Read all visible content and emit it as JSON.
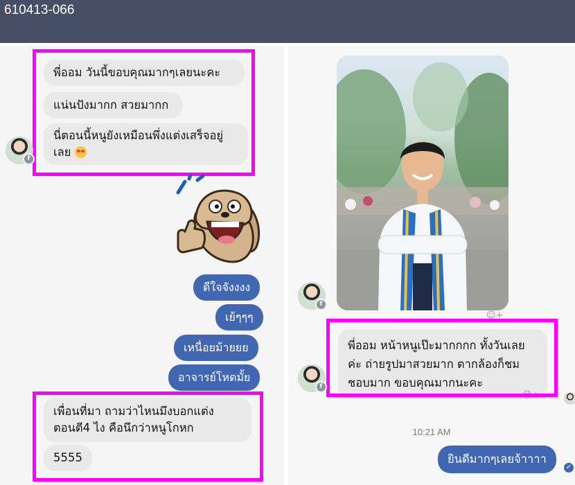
{
  "header": {
    "title": "610413-066"
  },
  "left": {
    "top_messages": [
      "พี่ออม วันนี้ขอบคุณมากๆเลยนะคะ",
      "แน่นปังมากก สวยมากก",
      "นี่ตอนนี้หนูยังเหมือนพึ่งแต่งเสร็จอยู่",
      "เลย"
    ],
    "sent_messages": [
      "ดีใจจังงงง",
      "เย้ๆๆๆ",
      "เหนื่อยม้ายยย",
      "อาจารย์โหดมั้ย"
    ],
    "bottom_messages": [
      "เพื่อนที่มา ถามว่าไหนมึงบอกแต่ง",
      "ตอนตี4 ไง คือนึกว่าหนูโกหก",
      "5555"
    ]
  },
  "right": {
    "message_lines": [
      "พี่ออม หน้าหนูเป๊ะมากกกก ทั้งวันเลย",
      "ค่ะ ถ่ายรูปมาสวยมาก ตากล้องก็ชม",
      "ชอบมาก ขอบคุณมากนะคะ"
    ],
    "timestamp": "10:21 AM",
    "sent_message": "ยินดีมากๆเลยจ้าาาา"
  },
  "icons": {
    "reaction": "add-reaction-icon",
    "facebook_badge": "facebook-badge-icon",
    "seen": "seen-check-icon",
    "emoji": "heart-eyes-emoji-icon"
  },
  "colors": {
    "highlight": "#ff00ff",
    "sent_bubble": "#4267b2",
    "header": "#474f66"
  }
}
